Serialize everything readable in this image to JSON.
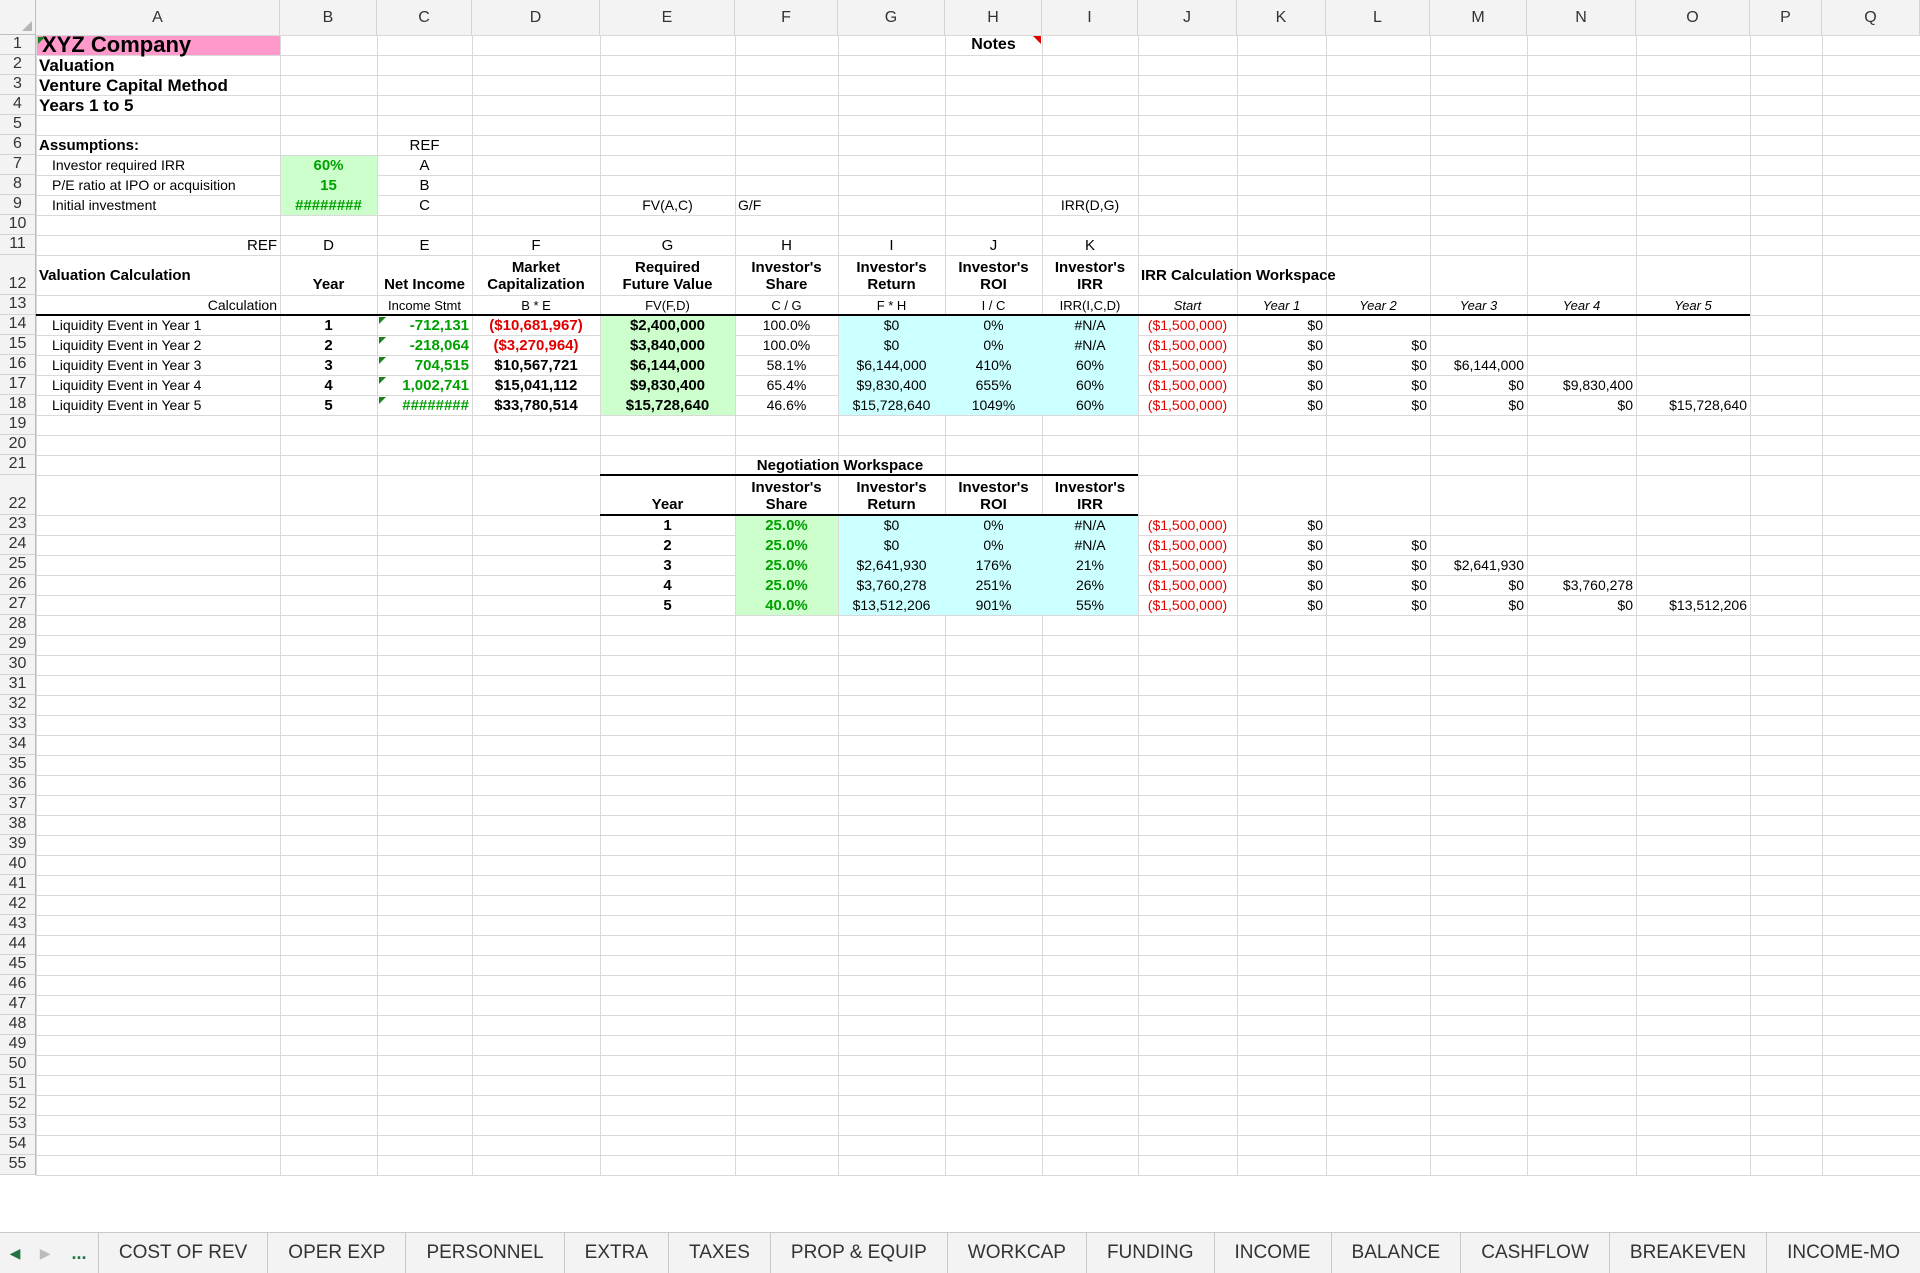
{
  "columns": [
    "A",
    "B",
    "C",
    "D",
    "E",
    "F",
    "G",
    "H",
    "I",
    "J",
    "K",
    "L",
    "M",
    "N",
    "O",
    "P",
    "Q"
  ],
  "rows": [
    "1",
    "2",
    "3",
    "4",
    "5",
    "6",
    "7",
    "8",
    "9",
    "10",
    "11",
    "12",
    "13",
    "14",
    "15",
    "16",
    "17",
    "18",
    "19",
    "20",
    "21",
    "22",
    "23",
    "24",
    "25",
    "26",
    "27",
    "28",
    "29",
    "30",
    "31",
    "32",
    "33",
    "34",
    "35",
    "36",
    "37",
    "38",
    "39",
    "40",
    "41",
    "42",
    "43",
    "44",
    "45",
    "46",
    "47",
    "48",
    "49",
    "50",
    "51",
    "52",
    "53",
    "54",
    "55"
  ],
  "header": {
    "company": "XYZ Company",
    "title1": "Valuation",
    "title2": "Venture Capital Method",
    "title3": "Years 1 to 5",
    "notes": "Notes"
  },
  "assumptions": {
    "heading": "Assumptions:",
    "ref_label": "REF",
    "items": [
      {
        "label": "Investor required IRR",
        "value": "60%",
        "ref": "A"
      },
      {
        "label": "P/E ratio at IPO or acquisition",
        "value": "15",
        "ref": "B"
      },
      {
        "label": "Initial investment",
        "value": "########",
        "ref": "C"
      }
    ],
    "formula_e9": "FV(A,C)",
    "formula_f9": "G/F",
    "formula_i9": "IRR(D,G)"
  },
  "ref_row": {
    "a": "REF",
    "b": "D",
    "c": "E",
    "d": "F",
    "e": "G",
    "f": "H",
    "g": "I",
    "h": "J",
    "i": "K"
  },
  "valuation": {
    "heading": "Valuation Calculation",
    "calc_label": "Calculation",
    "col_headers": [
      {
        "line1": "",
        "line2": "Year",
        "calc": ""
      },
      {
        "line1": "",
        "line2": "Net Income",
        "calc": "Income Stmt"
      },
      {
        "line1": "Market",
        "line2": "Capitalization",
        "calc": "B * E"
      },
      {
        "line1": "Required",
        "line2": "Future Value",
        "calc": "FV(F,D)"
      },
      {
        "line1": "Investor's",
        "line2": "Share",
        "calc": "C / G"
      },
      {
        "line1": "Investor's",
        "line2": "Return",
        "calc": "F * H"
      },
      {
        "line1": "Investor's",
        "line2": "ROI",
        "calc": "I / C"
      },
      {
        "line1": "Investor's",
        "line2": "IRR",
        "calc": "IRR(I,C,D)"
      }
    ],
    "rows": [
      {
        "label": "Liquidity Event in Year 1",
        "year": "1",
        "net_income": "-712,131",
        "market_cap": "($10,681,967)",
        "req_fv": "$2,400,000",
        "share": "100.0%",
        "ret": "$0",
        "roi": "0%",
        "irr": "#N/A"
      },
      {
        "label": "Liquidity Event in Year 2",
        "year": "2",
        "net_income": "-218,064",
        "market_cap": "($3,270,964)",
        "req_fv": "$3,840,000",
        "share": "100.0%",
        "ret": "$0",
        "roi": "0%",
        "irr": "#N/A"
      },
      {
        "label": "Liquidity Event in Year 3",
        "year": "3",
        "net_income": "704,515",
        "market_cap": "$10,567,721",
        "req_fv": "$6,144,000",
        "share": "58.1%",
        "ret": "$6,144,000",
        "roi": "410%",
        "irr": "60%"
      },
      {
        "label": "Liquidity Event in Year 4",
        "year": "4",
        "net_income": "1,002,741",
        "market_cap": "$15,041,112",
        "req_fv": "$9,830,400",
        "share": "65.4%",
        "ret": "$9,830,400",
        "roi": "655%",
        "irr": "60%"
      },
      {
        "label": "Liquidity Event in Year 5",
        "year": "5",
        "net_income": "########",
        "market_cap": "$33,780,514",
        "req_fv": "$15,728,640",
        "share": "46.6%",
        "ret": "$15,728,640",
        "roi": "1049%",
        "irr": "60%"
      }
    ]
  },
  "irr_workspace": {
    "heading": "IRR Calculation Workspace",
    "col_headers": [
      "Start",
      "Year 1",
      "Year 2",
      "Year 3",
      "Year 4",
      "Year 5"
    ],
    "rows": [
      [
        "($1,500,000)",
        "$0",
        "",
        "",
        "",
        ""
      ],
      [
        "($1,500,000)",
        "$0",
        "$0",
        "",
        "",
        ""
      ],
      [
        "($1,500,000)",
        "$0",
        "$0",
        "$6,144,000",
        "",
        ""
      ],
      [
        "($1,500,000)",
        "$0",
        "$0",
        "$0",
        "$9,830,400",
        ""
      ],
      [
        "($1,500,000)",
        "$0",
        "$0",
        "$0",
        "$0",
        "$15,728,640"
      ]
    ]
  },
  "negotiation": {
    "heading": "Negotiation Workspace",
    "col_headers": [
      {
        "line1": "",
        "line2": "Year"
      },
      {
        "line1": "Investor's",
        "line2": "Share"
      },
      {
        "line1": "Investor's",
        "line2": "Return"
      },
      {
        "line1": "Investor's",
        "line2": "ROI"
      },
      {
        "line1": "Investor's",
        "line2": "IRR"
      }
    ],
    "rows": [
      {
        "year": "1",
        "share": "25.0%",
        "ret": "$0",
        "roi": "0%",
        "irr": "#N/A",
        "irr_ws": [
          "($1,500,000)",
          "$0",
          "",
          "",
          "",
          ""
        ]
      },
      {
        "year": "2",
        "share": "25.0%",
        "ret": "$0",
        "roi": "0%",
        "irr": "#N/A",
        "irr_ws": [
          "($1,500,000)",
          "$0",
          "$0",
          "",
          "",
          ""
        ]
      },
      {
        "year": "3",
        "share": "25.0%",
        "ret": "$2,641,930",
        "roi": "176%",
        "irr": "21%",
        "irr_ws": [
          "($1,500,000)",
          "$0",
          "$0",
          "$2,641,930",
          "",
          ""
        ]
      },
      {
        "year": "4",
        "share": "25.0%",
        "ret": "$3,760,278",
        "roi": "251%",
        "irr": "26%",
        "irr_ws": [
          "($1,500,000)",
          "$0",
          "$0",
          "$0",
          "$3,760,278",
          ""
        ]
      },
      {
        "year": "5",
        "share": "40.0%",
        "ret": "$13,512,206",
        "roi": "901%",
        "irr": "55%",
        "irr_ws": [
          "($1,500,000)",
          "$0",
          "$0",
          "$0",
          "$0",
          "$13,512,206"
        ]
      }
    ]
  },
  "tabs": [
    "COST OF REV",
    "OPER EXP",
    "PERSONNEL",
    "EXTRA",
    "TAXES",
    "PROP & EQUIP",
    "WORKCAP",
    "FUNDING",
    "INCOME",
    "BALANCE",
    "CASHFLOW",
    "BREAKEVEN",
    "INCOME-MO"
  ],
  "tab_nav": {
    "prev": "◀",
    "next": "▶",
    "more": "..."
  },
  "colors": {
    "pink": "#ff99cc",
    "light_green": "#ccffcc",
    "light_cyan": "#ccffff",
    "red_text": "#e00000",
    "green_text": "#00a000",
    "accent": "#217346"
  }
}
